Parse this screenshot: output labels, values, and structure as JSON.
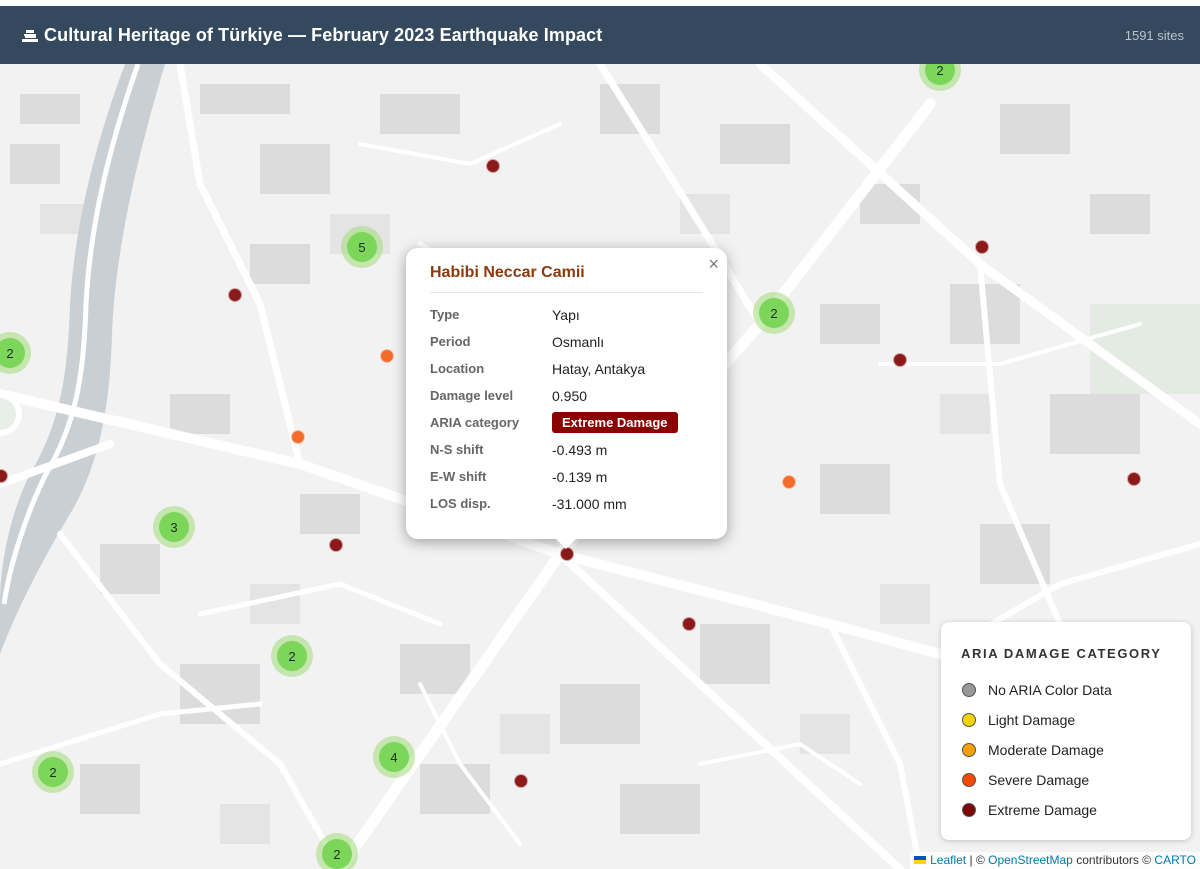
{
  "header": {
    "title": "Cultural Heritage of Türkiye — February 2023 Earthquake Impact",
    "count": "1591 sites"
  },
  "clusters": [
    {
      "id": "c1",
      "count": "2"
    },
    {
      "id": "c2",
      "count": "5"
    },
    {
      "id": "c3",
      "count": "2"
    },
    {
      "id": "c4",
      "count": "2"
    },
    {
      "id": "c5",
      "count": "3"
    },
    {
      "id": "c6",
      "count": "2"
    },
    {
      "id": "c7",
      "count": "4"
    },
    {
      "id": "c8",
      "count": "2"
    },
    {
      "id": "c9",
      "count": "2"
    }
  ],
  "popup": {
    "title": "Habibi Neccar Camii",
    "close": "×",
    "rows": [
      {
        "label": "Type",
        "value": "Yapı"
      },
      {
        "label": "Period",
        "value": "Osmanlı"
      },
      {
        "label": "Location",
        "value": "Hatay, Antakya"
      },
      {
        "label": "Damage level",
        "value": "0.950"
      },
      {
        "label": "ARIA category",
        "value": "Extreme Damage"
      },
      {
        "label": "N-S shift",
        "value": "-0.493 m"
      },
      {
        "label": "E-W shift",
        "value": "-0.139 m"
      },
      {
        "label": "LOS disp.",
        "value": "-31.000 mm"
      }
    ]
  },
  "legend": {
    "title": "ARIA DAMAGE CATEGORY",
    "items": [
      {
        "label": "No ARIA Color Data",
        "color": "#999999"
      },
      {
        "label": "Light Damage",
        "color": "#f5d300"
      },
      {
        "label": "Moderate Damage",
        "color": "#f5a000"
      },
      {
        "label": "Severe Damage",
        "color": "#f54a00"
      },
      {
        "label": "Extreme Damage",
        "color": "#7a0a0a"
      }
    ]
  },
  "colors": {
    "extreme": "#8b1a1a",
    "severe": "#f26b2a",
    "header": "#34495e",
    "cluster": "#7cd65a"
  },
  "attribution": {
    "leaflet": "Leaflet",
    "sep": "|",
    "copy1": "©",
    "osm": "OpenStreetMap",
    "contrib": "contributors",
    "copy2": "©",
    "carto": "CARTO"
  }
}
